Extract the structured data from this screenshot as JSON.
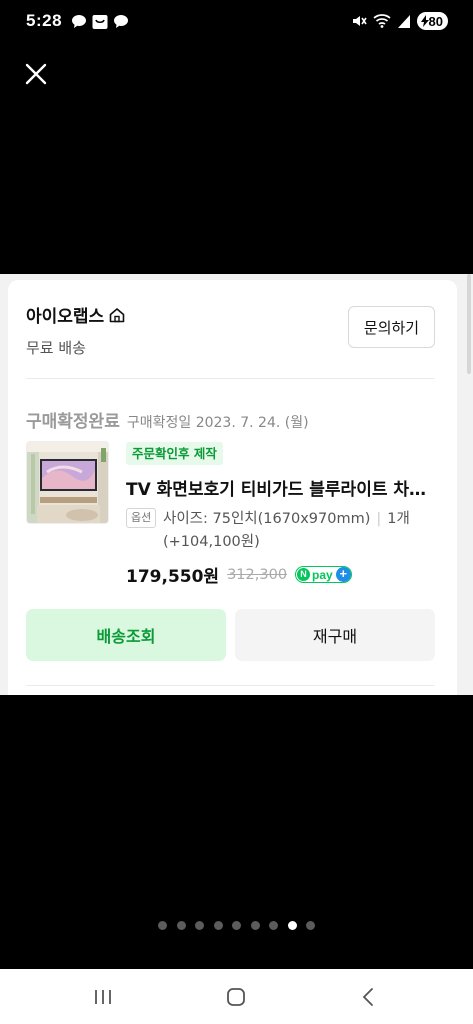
{
  "status_bar": {
    "time": "5:28",
    "battery": "80",
    "icons": [
      "chat-bubble-icon",
      "smile-bag-icon",
      "chat-bubble-icon",
      "mute-icon",
      "wifi-icon",
      "signal-icon",
      "battery-charging-icon"
    ]
  },
  "close_icon": "close-icon",
  "store": {
    "name": "아이오랩스",
    "shipping": "무료 배송",
    "inquiry_label": "문의하기"
  },
  "order": {
    "status": "구매확정완료",
    "confirm_date": "구매확정일 2023. 7. 24. (월)",
    "badge": "주문확인후 제작",
    "product_title": "TV 화면보호기 티비가드 블루라이트 차단…",
    "option_tag": "옵션",
    "option_size": "사이즈: 75인치(1670x970mm)",
    "option_qty": "1개 (+104,100원)",
    "price": "179,550원",
    "original_price": "312,300",
    "npay_label": "pay"
  },
  "buttons": {
    "track": "배송조회",
    "rebuy": "재구매"
  },
  "pager": {
    "count": 9,
    "active_index": 7
  },
  "nav": {
    "icons": [
      "recent-apps-icon",
      "home-icon",
      "back-icon"
    ]
  },
  "colors": {
    "accent_green": "#03c75a",
    "badge_green": "#0a9a36",
    "npay_blue": "#1e8ee6"
  }
}
